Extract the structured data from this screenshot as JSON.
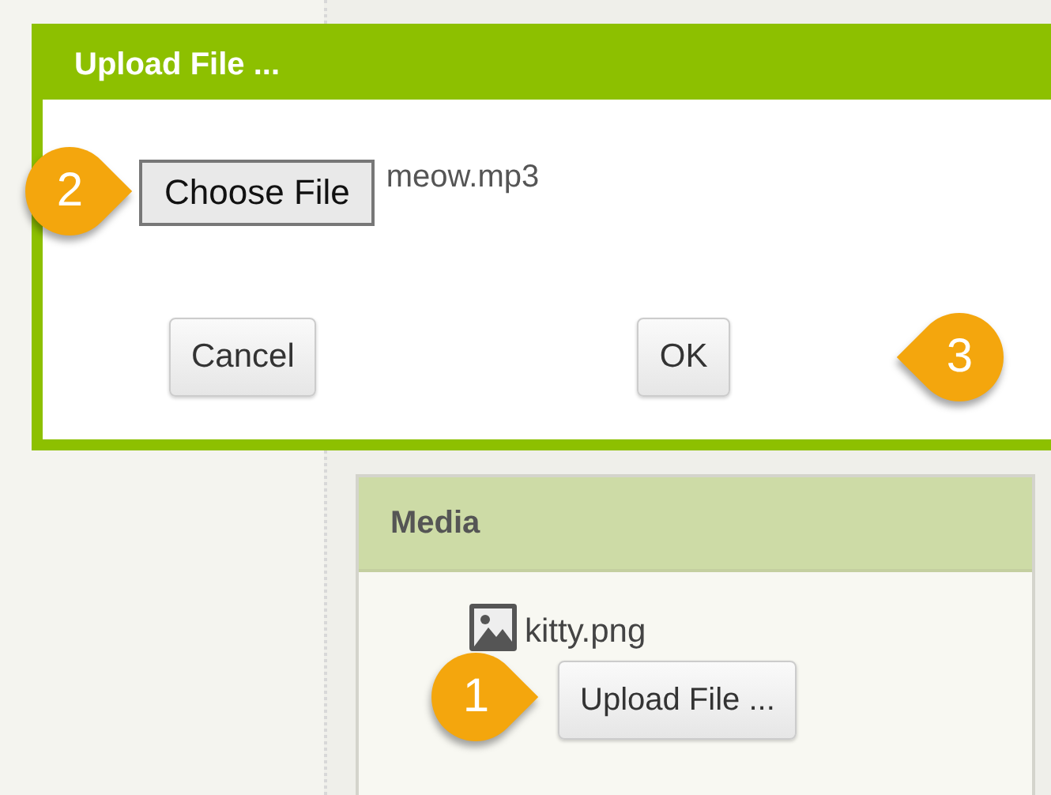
{
  "dialog": {
    "title": "Upload File ...",
    "choose_button": "Choose File",
    "file_name": "meow.mp3",
    "choose_callout": "2",
    "buttons": [
      "Cancel",
      "OK"
    ],
    "ok_callout": "3"
  },
  "media": {
    "title": "Media",
    "files": [
      {
        "name": "kitty.png"
      }
    ],
    "upload_button": "Upload File ...",
    "upload_callout": "1"
  }
}
